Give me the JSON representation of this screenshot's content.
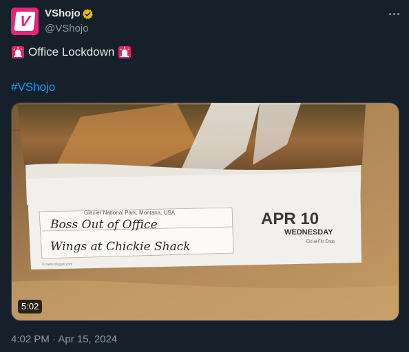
{
  "tweet": {
    "display_name": "VShojo",
    "handle": "@VShojo",
    "avatar_letter": "V",
    "text": "Office Lockdown",
    "hashtag": "#VShojo",
    "timestamp": "4:02 PM · Apr 15, 2024"
  },
  "media": {
    "duration": "5:02",
    "calendar": {
      "location": "Glacier National Park, Montana, USA",
      "date": "APR 10",
      "weekday": "WEDNESDAY",
      "holiday": "Eid al-Fitr Ends",
      "note_line1": "Boss Out of Office",
      "note_line2": "Wings at Chickie Shack",
      "credit": "© www.shagan.com"
    }
  },
  "colors": {
    "background": "#15202b",
    "text": "#e7e9ea",
    "secondary": "#8b98a5",
    "link": "#1d9bf0",
    "brand": "#e8237b",
    "verified": "#e2b719"
  },
  "icons": [
    "verified-badge-icon",
    "more-icon",
    "siren-icon"
  ]
}
